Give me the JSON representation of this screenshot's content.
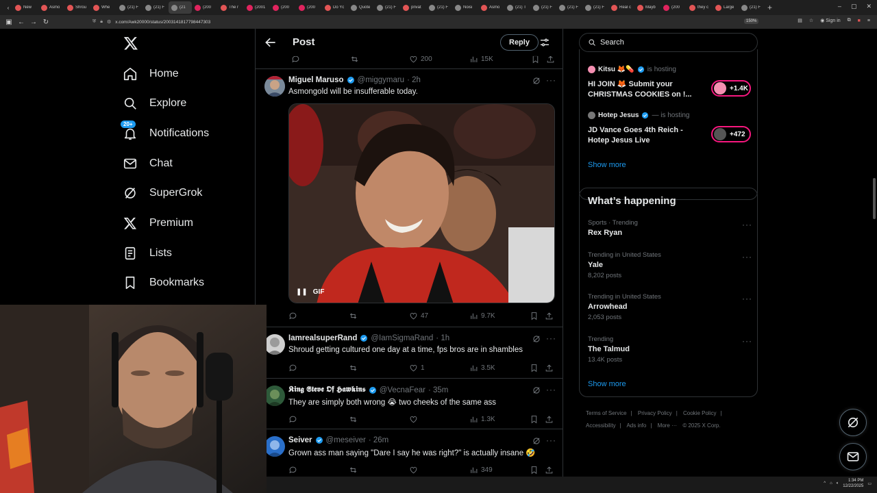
{
  "browser": {
    "tabs": [
      {
        "title": "New",
        "color": "#e25555"
      },
      {
        "title": "Asmo",
        "color": "#e25555"
      },
      {
        "title": "Shrou",
        "color": "#e25555"
      },
      {
        "title": "Whe",
        "color": "#e25555"
      },
      {
        "title": "(21) F",
        "color": "#888888"
      },
      {
        "title": "(21) F",
        "color": "#888888"
      },
      {
        "title": "(21",
        "color": "#888888"
      },
      {
        "title": "(200",
        "color": "#e0245e"
      },
      {
        "title": "The r",
        "color": "#e25555"
      },
      {
        "title": "(2001",
        "color": "#e0245e"
      },
      {
        "title": "(200",
        "color": "#e0245e"
      },
      {
        "title": "(200",
        "color": "#e0245e"
      },
      {
        "title": "Do Yc",
        "color": "#e25555"
      },
      {
        "title": "Quote",
        "color": "#888888"
      },
      {
        "title": "(21) F",
        "color": "#888888"
      },
      {
        "title": "privat",
        "color": "#e25555"
      },
      {
        "title": "(21) F",
        "color": "#888888"
      },
      {
        "title": "Noisi",
        "color": "#888888"
      },
      {
        "title": "Asmo",
        "color": "#e25555"
      },
      {
        "title": "(21) T",
        "color": "#888888"
      },
      {
        "title": "(21) F",
        "color": "#888888"
      },
      {
        "title": "(21) F",
        "color": "#888888"
      },
      {
        "title": "(21) F",
        "color": "#888888"
      },
      {
        "title": "Real c",
        "color": "#e25555"
      },
      {
        "title": "Mayb",
        "color": "#e25555"
      },
      {
        "title": "(200",
        "color": "#e0245e"
      },
      {
        "title": "they c",
        "color": "#e25555"
      },
      {
        "title": "Large",
        "color": "#e25555"
      },
      {
        "title": "(21) F",
        "color": "#888888"
      }
    ],
    "url": "x.com/Awk20000/status/2003141817798447303",
    "zoom": "150%",
    "sign_in": "Sign in"
  },
  "nav": {
    "items": [
      {
        "label": "Home"
      },
      {
        "label": "Explore"
      },
      {
        "label": "Notifications",
        "badge": "20+"
      },
      {
        "label": "Chat"
      },
      {
        "label": "SuperGrok"
      },
      {
        "label": "Premium"
      },
      {
        "label": "Lists"
      },
      {
        "label": "Bookmarks"
      }
    ]
  },
  "post": {
    "header_title": "Post",
    "reply_label": "Reply",
    "top_stats": {
      "likes": "200",
      "views": "15K"
    },
    "tweets": [
      {
        "name": "Miguel Maruso",
        "handle": "@miggymaru",
        "time": "· 2h",
        "text": "Asmongold will be insufferable today.",
        "gif_label": "GIF",
        "likes": "47",
        "views": "9.7K",
        "replies": "",
        "reposts": ""
      },
      {
        "name": "IamrealsuperRand",
        "handle": "@IamSigmaRand",
        "time": "· 1h",
        "text": "Shroud getting cultured one day at a time, fps bros are in shambles",
        "likes": "1",
        "views": "3.5K"
      },
      {
        "name": "𝕶𝖎𝖓𝖌 𝕾𝖙𝖊𝖛𝖊 𝕺𝖋 𝕳𝖆𝖜𝖐𝖎𝖓𝖘",
        "handle": "@VecnaFear",
        "time": "· 35m",
        "text": "They are simply both wrong 😭 two cheeks of the same ass",
        "likes": "",
        "views": "1.3K"
      },
      {
        "name": "Seiver",
        "handle": "@meseiver",
        "time": "· 26m",
        "text": "Grown ass man saying \"Dare I say he was right?\" is actually insane 🤣",
        "likes": "",
        "views": "349"
      }
    ]
  },
  "right": {
    "search_placeholder": "Search",
    "spaces": [
      {
        "host": "Kitsu 🦊💊",
        "hosting": "is hosting",
        "title": "HI JOIN 🦊 Submit your CHRISTMAS COOKIES on !...",
        "count": "+1.4K",
        "pill_color": "#f48fb1"
      },
      {
        "host": "Hotep Jesus",
        "hosting": "— is hosting",
        "title": "JD Vance Goes 4th Reich - Hotep Jesus Live",
        "count": "+472",
        "pill_color": "#555555"
      }
    ],
    "spaces_show_more": "Show more",
    "whats_happening": "What’s happening",
    "trends": [
      {
        "category": "Sports · Trending",
        "name": "Rex Ryan",
        "posts": ""
      },
      {
        "category": "Trending in United States",
        "name": "Yale",
        "posts": "8,202 posts"
      },
      {
        "category": "Trending in United States",
        "name": "Arrowhead",
        "posts": "2,053 posts"
      },
      {
        "category": "Trending",
        "name": "The Talmud",
        "posts": "13.4K posts"
      }
    ],
    "trends_show_more": "Show more",
    "footer": [
      "Terms of Service",
      "|",
      "Privacy Policy",
      "|",
      "Cookie Policy",
      "|",
      "Accessibility",
      "|",
      "Ads info",
      "|",
      "More ···",
      "© 2025 X Corp."
    ]
  },
  "taskbar": {
    "time": "1:34 PM",
    "date": "12/22/2025"
  },
  "colors": {
    "accent": "#1d9bf0",
    "live_pink": "#f91880",
    "border": "#2f3336",
    "muted": "#71767b"
  }
}
